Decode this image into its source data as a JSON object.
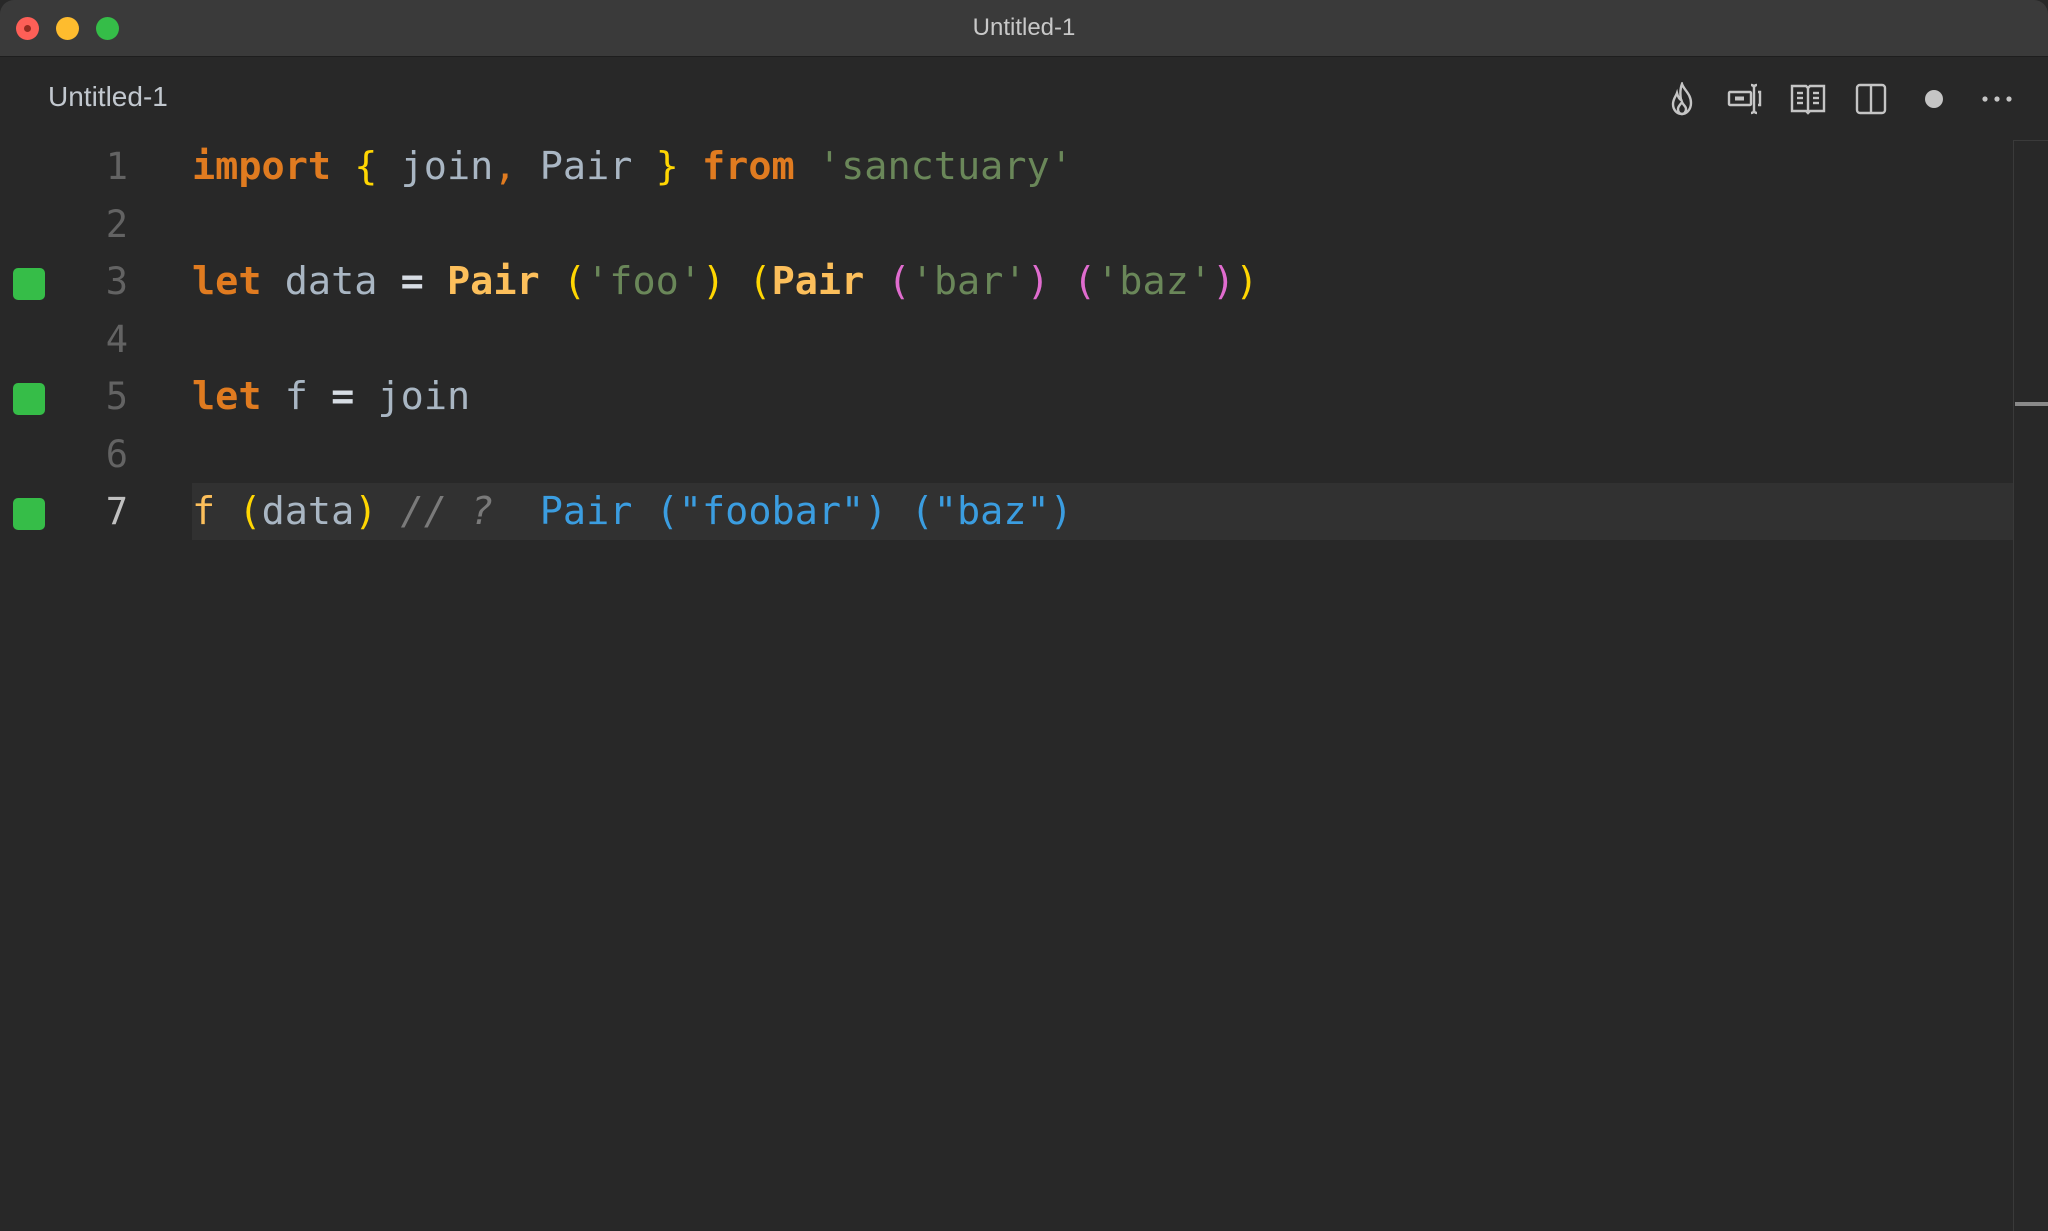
{
  "window": {
    "title": "Untitled-1",
    "controls": [
      "close",
      "minimize",
      "maximize"
    ]
  },
  "tab": {
    "label": "Untitled-1",
    "dirty": true
  },
  "toolbar": {
    "items": [
      {
        "icon": "flame-icon",
        "label": "Quokka"
      },
      {
        "icon": "value-inspect-icon",
        "label": "Inspect"
      },
      {
        "icon": "open-preview-icon",
        "label": "Open Preview"
      },
      {
        "icon": "split-editor-icon",
        "label": "Split Editor"
      },
      {
        "icon": "unsaved-dot-icon",
        "label": "Unsaved"
      },
      {
        "icon": "more-actions-icon",
        "label": "More Actions"
      }
    ]
  },
  "editor": {
    "colors": {
      "keyword": "#e07b20",
      "type": "#fcbf5b",
      "identifier": "#a9b6c3",
      "string": "#6a8759",
      "bracket1": "#ffd602",
      "bracket2": "#e06ccf",
      "comment": "#7a7a7a",
      "inline_result": "#3b9de0",
      "coverage_marker": "#36bd48"
    },
    "current_line": 7,
    "lines": [
      {
        "number": "1",
        "marker": false,
        "tokens": [
          {
            "t": "import",
            "c": "kw"
          },
          {
            "t": " ",
            "c": "id"
          },
          {
            "t": "{",
            "c": "br1"
          },
          {
            "t": " join",
            "c": "id"
          },
          {
            "t": ",",
            "c": "pn"
          },
          {
            "t": " Pair ",
            "c": "id"
          },
          {
            "t": "}",
            "c": "br1"
          },
          {
            "t": " ",
            "c": "id"
          },
          {
            "t": "from",
            "c": "kw"
          },
          {
            "t": " ",
            "c": "id"
          },
          {
            "t": "'sanctuary'",
            "c": "st"
          }
        ]
      },
      {
        "number": "2",
        "marker": false,
        "tokens": []
      },
      {
        "number": "3",
        "marker": true,
        "tokens": [
          {
            "t": "let",
            "c": "kw"
          },
          {
            "t": " data ",
            "c": "id"
          },
          {
            "t": "=",
            "c": "op"
          },
          {
            "t": " ",
            "c": "id"
          },
          {
            "t": "Pair",
            "c": "ty"
          },
          {
            "t": " ",
            "c": "id"
          },
          {
            "t": "(",
            "c": "br1"
          },
          {
            "t": "'foo'",
            "c": "st"
          },
          {
            "t": ")",
            "c": "br1"
          },
          {
            "t": " ",
            "c": "id"
          },
          {
            "t": "(",
            "c": "br1"
          },
          {
            "t": "Pair",
            "c": "ty"
          },
          {
            "t": " ",
            "c": "id"
          },
          {
            "t": "(",
            "c": "br2"
          },
          {
            "t": "'bar'",
            "c": "st"
          },
          {
            "t": ")",
            "c": "br2"
          },
          {
            "t": " ",
            "c": "id"
          },
          {
            "t": "(",
            "c": "br2"
          },
          {
            "t": "'baz'",
            "c": "st"
          },
          {
            "t": ")",
            "c": "br2"
          },
          {
            "t": ")",
            "c": "br1"
          }
        ]
      },
      {
        "number": "4",
        "marker": false,
        "tokens": []
      },
      {
        "number": "5",
        "marker": true,
        "tokens": [
          {
            "t": "let",
            "c": "kw"
          },
          {
            "t": " f ",
            "c": "id"
          },
          {
            "t": "=",
            "c": "op"
          },
          {
            "t": " join",
            "c": "id"
          }
        ]
      },
      {
        "number": "6",
        "marker": false,
        "tokens": []
      },
      {
        "number": "7",
        "marker": true,
        "tokens": [
          {
            "t": "f",
            "c": "fn"
          },
          {
            "t": " ",
            "c": "id"
          },
          {
            "t": "(",
            "c": "br1"
          },
          {
            "t": "data",
            "c": "id"
          },
          {
            "t": ")",
            "c": "br1"
          },
          {
            "t": " ",
            "c": "id"
          },
          {
            "t": "// ?",
            "c": "cm"
          },
          {
            "t": "  ",
            "c": "id"
          },
          {
            "t": "Pair (\"foobar\") (\"baz\")",
            "c": "res"
          }
        ]
      }
    ]
  }
}
